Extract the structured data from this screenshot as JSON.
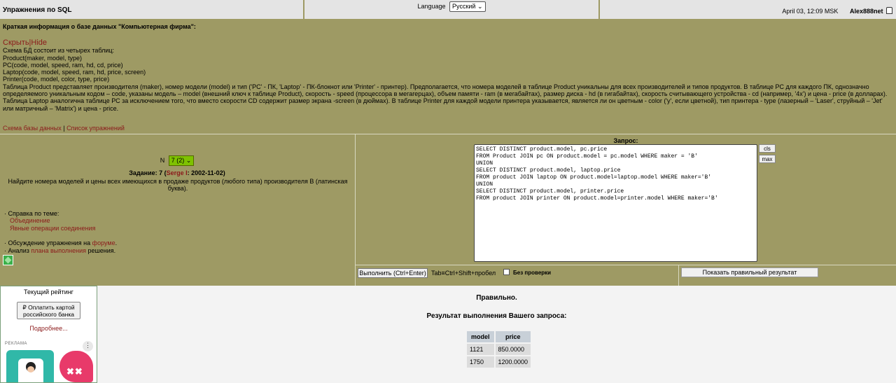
{
  "header": {
    "title": "Упражнения по SQL",
    "language_label": "Language",
    "language_value": "Русский",
    "datetime": "April 03, 12:09 MSK",
    "username": "Alex888net"
  },
  "info": {
    "title": "Краткая информация о базе данных \"Компьютерная фирма\":",
    "hide_link": "Скрыть|Hide",
    "lines": [
      "Схема БД состоит из четырех таблиц:",
      "Product(maker, model, type)",
      "PC(code, model, speed, ram, hd, cd, price)",
      "Laptop(code, model, speed, ram, hd, price, screen)",
      "Printer(code, model, color, type, price)"
    ],
    "description": "Таблица Product представляет производителя (maker), номер модели (model) и тип ('PC' - ПК, 'Laptop' - ПК-блокнот или 'Printer' - принтер). Предполагается, что номера моделей в таблице Product уникальны для всех производителей и типов продуктов. В таблице PC для каждого ПК, однозначно определяемого уникальным кодом – code, указаны модель – model (внешний ключ к таблице Product), скорость - speed (процессора в мегагерцах), объем памяти - ram (в мегабайтах), размер диска - hd (в гигабайтах), скорость считывающего устройства - cd (например, '4x') и цена - price (в долларах). Таблица Laptop аналогична таблице РС за исключением того, что вместо скорости CD содержит размер экрана -screen (в дюймах). В таблице Printer для каждой модели принтера указывается, является ли он цветным - color ('y', если цветной), тип принтера - type (лазерный – 'Laser', струйный – 'Jet' или матричный – 'Matrix') и цена - price.",
    "schema_link": "Схема базы данных",
    "separator": " | ",
    "exercises_link": "Список упражнений"
  },
  "task": {
    "n_label": "N",
    "n_value": "7 (2)",
    "title_prefix": "Задание: 7 (",
    "author": "Serge I",
    "title_suffix": ": 2002-11-02)",
    "text": "Найдите номера моделей и цены всех имеющихся в продаже продуктов (любого типа) производителя B (латинская буква).",
    "help_label": "· Справка по теме:",
    "help_links": [
      "Объединение",
      "Явные операции соединения"
    ],
    "discuss_prefix": "· Обсуждение упражнения на ",
    "discuss_link": "форуме",
    "discuss_suffix": ".",
    "plan_prefix": "· Анализ ",
    "plan_link": "плана выполнения",
    "plan_suffix": " решения."
  },
  "query": {
    "label": "Запрос:",
    "text": "SELECT DISTINCT product.model, pc.price\nFROM Product JOIN pc ON product.model = pc.model WHERE maker = 'B'\nUNION\nSELECT DISTINCT product.model, laptop.price\nFROM product JOIN laptop ON product.model=laptop.model WHERE maker='B'\nUNION\nSELECT DISTINCT product.model, printer.price\nFROM product JOIN printer ON product.model=printer.model WHERE maker='B'",
    "cls_label": "cls",
    "max_label": "max",
    "execute_label": "Выполнить (Ctrl+Enter)",
    "tab_hint": "Tab≡Ctrl+Shift+пробел",
    "no_check_label": "Без проверки",
    "show_result_label": "Показать правильный результат"
  },
  "sidebar": {
    "rating_label": "Текущий рейтинг",
    "pay_label": "₽ Оплатить картой российского банка",
    "more_link": "Подробнее...",
    "ad_label": "РЕКЛАМА",
    "ad_menu": "⋮"
  },
  "result": {
    "status": "Правильно.",
    "heading": "Результат выполнения Вашего запроса:",
    "columns": [
      "model",
      "price"
    ],
    "rows": [
      [
        "1121",
        "850.0000"
      ],
      [
        "1750",
        "1200.0000"
      ]
    ]
  }
}
